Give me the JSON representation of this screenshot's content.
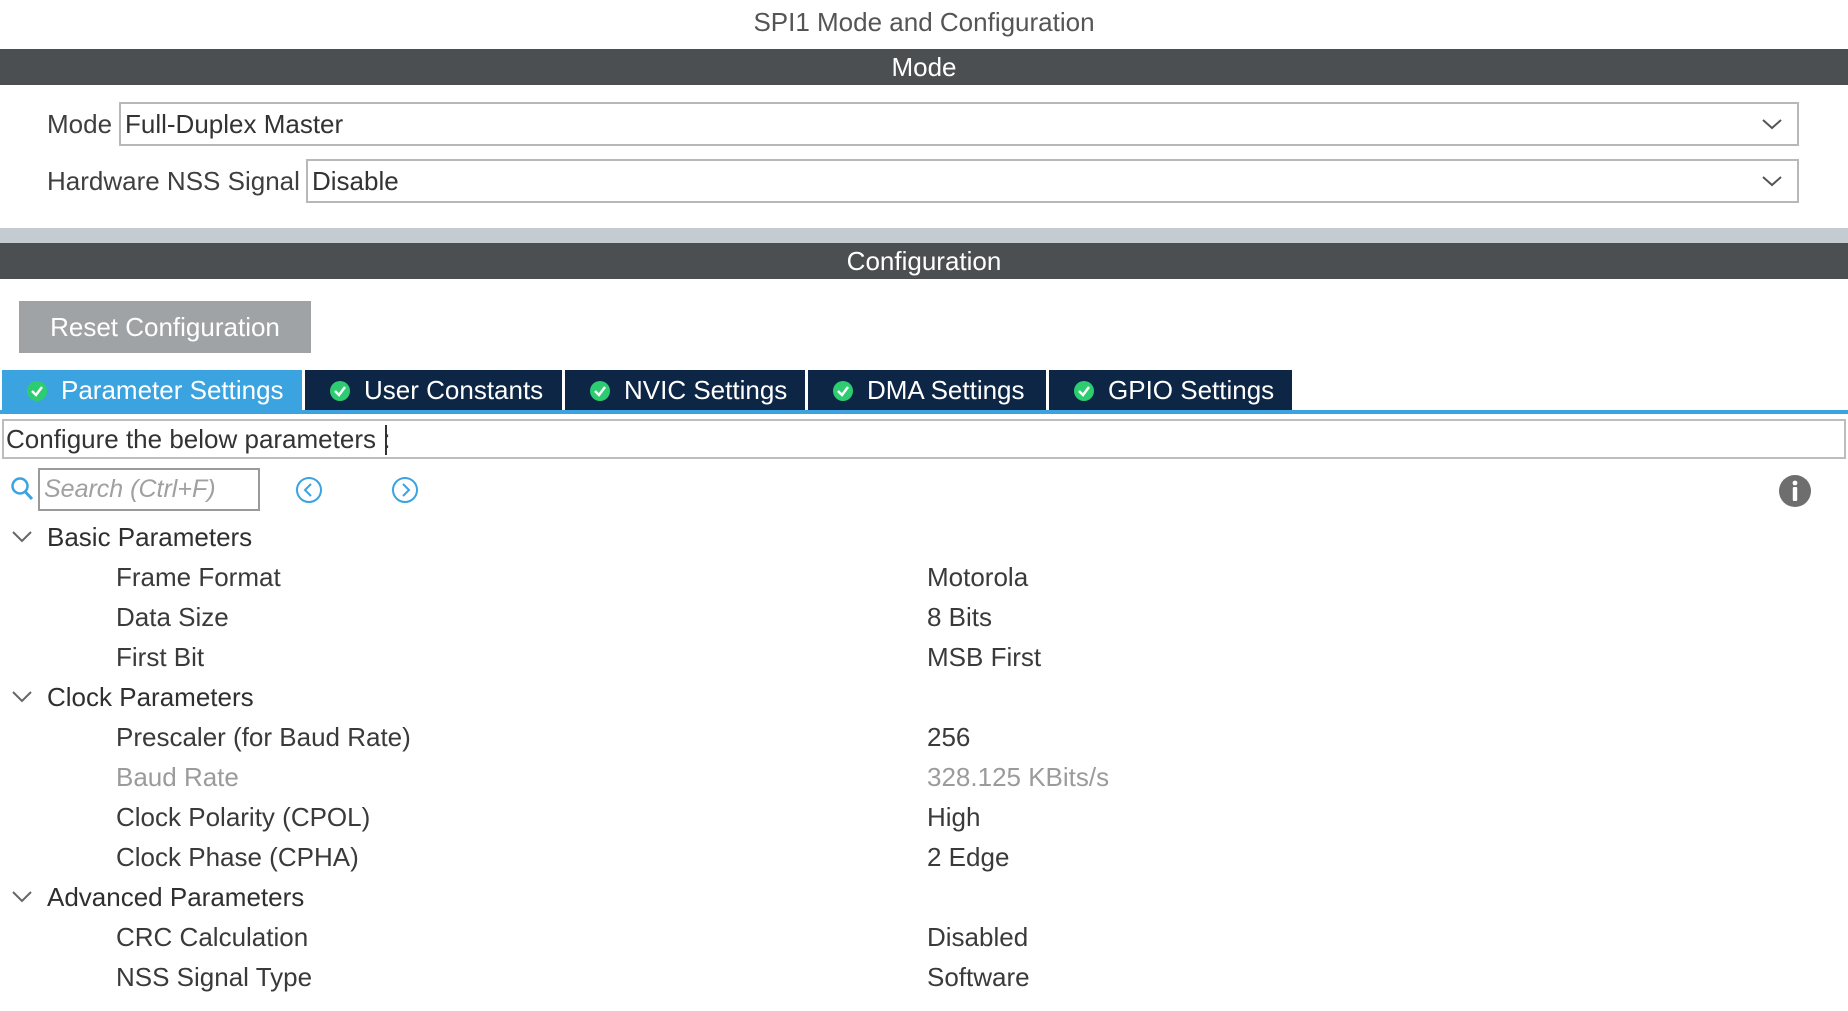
{
  "page_title": "SPI1 Mode and Configuration",
  "mode_section": {
    "header": "Mode",
    "fields": [
      {
        "label": "Mode",
        "value": "Full-Duplex Master"
      },
      {
        "label": "Hardware NSS Signal",
        "value": "Disable"
      }
    ]
  },
  "config_section": {
    "header": "Configuration",
    "reset_label": "Reset Configuration",
    "tabs": [
      {
        "label": "Parameter Settings",
        "active": true
      },
      {
        "label": "User Constants",
        "active": false
      },
      {
        "label": "NVIC Settings",
        "active": false
      },
      {
        "label": "DMA Settings",
        "active": false
      },
      {
        "label": "GPIO Settings",
        "active": false
      }
    ],
    "hint": "Configure the below parameters :",
    "search": {
      "placeholder": "Search (Ctrl+F)"
    },
    "groups": [
      {
        "label": "Basic Parameters",
        "params": [
          {
            "name": "Frame Format",
            "value": "Motorola"
          },
          {
            "name": "Data Size",
            "value": "8 Bits"
          },
          {
            "name": "First Bit",
            "value": "MSB First"
          }
        ]
      },
      {
        "label": "Clock Parameters",
        "params": [
          {
            "name": "Prescaler (for Baud Rate)",
            "value": "256"
          },
          {
            "name": "Baud Rate",
            "value": "328.125 KBits/s",
            "disabled": true
          },
          {
            "name": "Clock Polarity (CPOL)",
            "value": "High"
          },
          {
            "name": "Clock Phase (CPHA)",
            "value": "2 Edge"
          }
        ]
      },
      {
        "label": "Advanced Parameters",
        "params": [
          {
            "name": "CRC Calculation",
            "value": "Disabled"
          },
          {
            "name": "NSS Signal Type",
            "value": "Software"
          }
        ]
      }
    ]
  },
  "colors": {
    "section_header_bg": "#4b4f52",
    "tab_bg": "#0d2645",
    "tab_active_bg": "#3aa3e0",
    "tab_check": "#2ecc71",
    "reset_bg": "#a0a3a6",
    "link_blue": "#3aa3e0"
  },
  "icons": {
    "tab_icon": "check-circle-icon",
    "dropdown": "chevron-down-icon",
    "search": "search-icon",
    "prev": "chevron-left-circle-icon",
    "next": "chevron-right-circle-icon",
    "info": "info-icon",
    "group_toggle": "chevron-down-icon"
  }
}
